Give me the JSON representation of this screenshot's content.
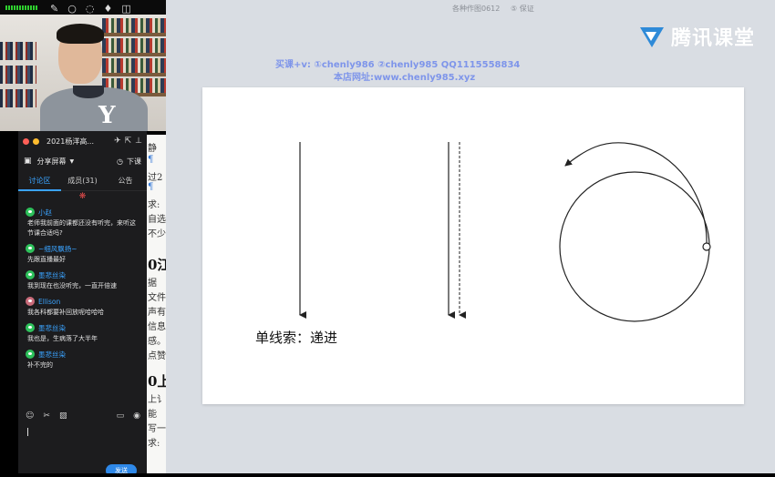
{
  "topbar": {
    "icons": [
      "pencil-icon",
      "circle-icon",
      "eraser-icon",
      "laser-icon",
      "line-width-icon",
      "settings-icon"
    ]
  },
  "document": {
    "title": "各种作图0612",
    "partial_right": "⑤ 保证"
  },
  "logo": {
    "text": "腾讯课堂",
    "color": "#ffffff"
  },
  "watermark": {
    "line1": "买课+v: ①chenly986 ②chenly985 QQ1115558834",
    "line2": "本店网址:www.chenly985.xyz",
    "color": "#7e95ea"
  },
  "slide": {
    "label": "单线索：递进"
  },
  "doc_strip": {
    "lines": [
      "静",
      "¶",
      "过2",
      "¶",
      "求:",
      "自选",
      "不少",
      "0江",
      "据",
      "文件",
      "声有",
      "信息",
      "感。",
      "点赞",
      "0上",
      "上讠",
      "能",
      "写一",
      "求:"
    ]
  },
  "chat": {
    "title": "2021杨洋高...",
    "share_label": "分享屏幕",
    "leave_label": "下课",
    "tabs": [
      {
        "label": "讨论区",
        "active": true
      },
      {
        "label": "成员(31)",
        "active": false
      },
      {
        "label": "公告",
        "active": false
      }
    ],
    "messages": [
      {
        "user": "小赵",
        "text": "老师我前面的课都还没有听完，来听这节课合适吗?",
        "avatar": "green"
      },
      {
        "user": "~细风飘扬~",
        "text": "先跟直播最好",
        "avatar": "green"
      },
      {
        "user": "墨悲丝染",
        "text": "我到现在也没听完，一直开倍速",
        "avatar": "green"
      },
      {
        "user": "Ellison",
        "text": "我各科都要补回放呢哈哈哈",
        "avatar": "photo"
      },
      {
        "user": "墨悲丝染",
        "text": "我也是，生病落了大半年",
        "avatar": "green"
      },
      {
        "user": "墨悲丝染",
        "text": "补不完的",
        "avatar": "green"
      }
    ],
    "send_label": "发送",
    "colors": {
      "accent": "#3aa3ff",
      "close": "#ff5f57",
      "minimize": "#febc2e"
    }
  }
}
